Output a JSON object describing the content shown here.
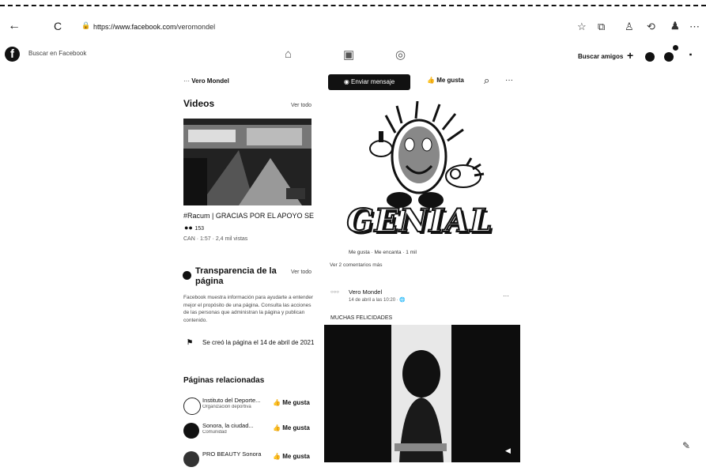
{
  "browser": {
    "url_prefix": "https://www.facebook.com",
    "url_rest": "/veromondel",
    "back": "←",
    "reload": "C",
    "lock": "🔒"
  },
  "facebook": {
    "logo": "f",
    "search_placeholder": "Buscar en Facebook",
    "find_friends": "Buscar amigos",
    "plus": "+"
  },
  "page": {
    "breadcrumb_prefix": "···",
    "breadcrumb_name": "Vero Mondel",
    "message_button": "Enviar mensaje",
    "like_button": "Me gusta",
    "more": "···"
  },
  "videos": {
    "heading": "Videos",
    "see_all": "Ver todo",
    "title": "#Racum | GRACIAS POR EL APOYO SE Q...",
    "reactions": "153",
    "meta": "CAN · 1:57 · 2,4 mil vistas"
  },
  "transparency": {
    "heading": "Transparencia de la página",
    "see_all": "Ver todo",
    "text": "Facebook muestra información para ayudarte a entender mejor el propósito de una página. Consulta las acciones de las personas que administran la página y publican contenido.",
    "created": "Se creó la página el 14 de abril de 2021"
  },
  "related": {
    "heading": "Páginas relacionadas",
    "items": [
      {
        "name": "Instituto del Deporte...",
        "sub": "Organización deportiva",
        "like": "Me gusta"
      },
      {
        "name": "Sonora, la ciudad...",
        "sub": "Comunidad",
        "like": "Me gusta"
      },
      {
        "name": "PRO BEAUTY Sonora",
        "sub": "",
        "like": "Me gusta"
      }
    ]
  },
  "post": {
    "image_text": "GENIAL",
    "reactions_text": "Me gusta · Me encanta · 1 mil",
    "comments_text": "Ver 2 comentarios más",
    "author": "Vero Mondel",
    "date": "14 de abril a las 10:20 · 🌐",
    "caption": "MUCHAS FELICIDADES",
    "more": "···"
  },
  "icon_names": [
    "back-arrow-icon",
    "reload-icon",
    "lock-icon",
    "star-icon",
    "extensions-icon",
    "profile-icon",
    "home-icon",
    "watch-icon",
    "groups-icon",
    "messenger-icon",
    "bell-icon",
    "edit-icon"
  ]
}
